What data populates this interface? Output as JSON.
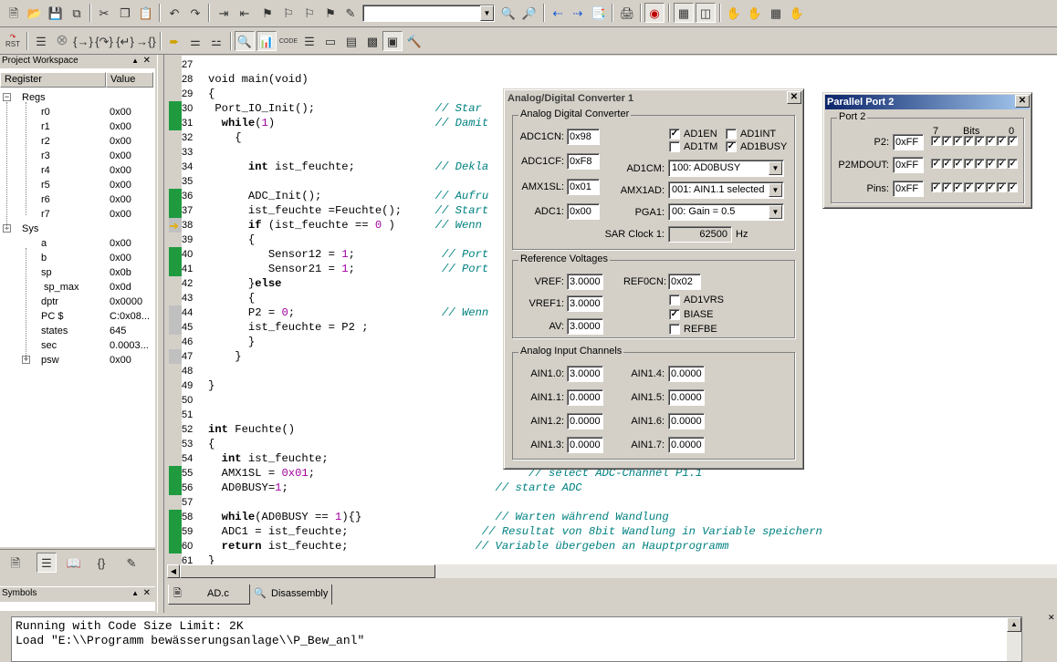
{
  "toolbar1": {
    "icons": [
      "new-file-icon",
      "open-folder-icon",
      "save-icon",
      "save-all-icon",
      "cut-icon",
      "copy-icon",
      "paste-icon",
      "undo-icon",
      "redo-icon",
      "indent-icon",
      "unindent-icon",
      "bookmark-icon",
      "bookmark-next-icon",
      "bookmark-prev-icon",
      "bookmark-clear-icon",
      "find-combo",
      "find-icon",
      "find-in-files-icon",
      "nav-back-icon",
      "nav-forward-icon",
      "source-browser-icon",
      "print-icon",
      "debug-session-icon",
      "window-icon",
      "window-tile-icon",
      "hand-icon",
      "hand2-icon",
      "grid-icon",
      "hand3-icon"
    ],
    "find_value": ""
  },
  "toolbar2": {
    "rst": "RST"
  },
  "workspace": {
    "title": "Project Workspace",
    "col_register": "Register",
    "col_value": "Value",
    "regs_label": "Regs",
    "sys_label": "Sys",
    "regs": [
      {
        "name": "r0",
        "value": "0x00"
      },
      {
        "name": "r1",
        "value": "0x00"
      },
      {
        "name": "r2",
        "value": "0x00"
      },
      {
        "name": "r3",
        "value": "0x00"
      },
      {
        "name": "r4",
        "value": "0x00"
      },
      {
        "name": "r5",
        "value": "0x00"
      },
      {
        "name": "r6",
        "value": "0x00"
      },
      {
        "name": "r7",
        "value": "0x00"
      }
    ],
    "sys": [
      {
        "name": "a",
        "value": "0x00"
      },
      {
        "name": "b",
        "value": "0x00"
      },
      {
        "name": "sp",
        "value": "0x0b"
      },
      {
        "name": "sp_max",
        "value": "0x0d"
      },
      {
        "name": "dptr",
        "value": "0x0000"
      },
      {
        "name": "PC  $",
        "value": "C:0x08..."
      },
      {
        "name": "states",
        "value": "645"
      },
      {
        "name": "sec",
        "value": "0.0003..."
      },
      {
        "name": "psw",
        "value": "0x00"
      }
    ]
  },
  "symbols": {
    "title": "Symbols"
  },
  "editor": {
    "lines": [
      {
        "n": "27",
        "m": "",
        "t": ""
      },
      {
        "n": "28",
        "m": "",
        "t": "void main(void)"
      },
      {
        "n": "29",
        "m": "",
        "t": "{"
      },
      {
        "n": "30",
        "m": "g",
        "t": " Port_IO_Init();                  // Star"
      },
      {
        "n": "31",
        "m": "g",
        "t": "  while(1)                        // Damit"
      },
      {
        "n": "32",
        "m": "",
        "t": "    {"
      },
      {
        "n": "33",
        "m": "",
        "t": ""
      },
      {
        "n": "34",
        "m": "",
        "t": "      int ist_feuchte;            // Dekla"
      },
      {
        "n": "35",
        "m": "",
        "t": ""
      },
      {
        "n": "36",
        "m": "g",
        "t": "      ADC_Init();                 // Aufru"
      },
      {
        "n": "37",
        "m": "g",
        "t": "      ist_feuchte =Feuchte();     // Start"
      },
      {
        "n": "38",
        "m": "y",
        "t": "      if (ist_feuchte == 0 )      // Wenn"
      },
      {
        "n": "39",
        "m": "",
        "t": "      {"
      },
      {
        "n": "40",
        "m": "g",
        "t": "         Sensor12 = 1;             // Port"
      },
      {
        "n": "41",
        "m": "g",
        "t": "         Sensor21 = 1;             // Port"
      },
      {
        "n": "42",
        "m": "",
        "t": "      }else"
      },
      {
        "n": "43",
        "m": "",
        "t": "      {"
      },
      {
        "n": "44",
        "m": "y",
        "t": "      P2 = 0;                      // Wenn"
      },
      {
        "n": "45",
        "m": "y",
        "t": "      ist_feuchte = P2 ;"
      },
      {
        "n": "46",
        "m": "",
        "t": "      }"
      },
      {
        "n": "47",
        "m": "y",
        "t": "    }"
      },
      {
        "n": "48",
        "m": "",
        "t": ""
      },
      {
        "n": "49",
        "m": "",
        "t": "}"
      },
      {
        "n": "50",
        "m": "",
        "t": ""
      },
      {
        "n": "51",
        "m": "",
        "t": ""
      },
      {
        "n": "52",
        "m": "",
        "t": "int Feuchte()"
      },
      {
        "n": "53",
        "m": "",
        "t": "{"
      },
      {
        "n": "54",
        "m": "",
        "t": "  int ist_feuchte;"
      },
      {
        "n": "55",
        "m": "g",
        "t": "  AMX1SL = 0x01;                                // select ADC-Channel P1.1"
      },
      {
        "n": "56",
        "m": "g",
        "t": "  AD0BUSY=1;                               // starte ADC"
      },
      {
        "n": "57",
        "m": "",
        "t": ""
      },
      {
        "n": "58",
        "m": "g",
        "t": "  while(AD0BUSY == 1){}                    // Warten während Wandlung"
      },
      {
        "n": "59",
        "m": "g",
        "t": "  ADC1 = ist_feuchte;                    // Resultat von 8bit Wandlung in Variable speichern"
      },
      {
        "n": "60",
        "m": "g",
        "t": "  return ist_feuchte;                   // Variable übergeben an Hauptprogramm"
      },
      {
        "n": "61",
        "m": "",
        "t": "}"
      }
    ],
    "tabs": [
      {
        "label": "AD.c"
      },
      {
        "label": "Disassembly"
      }
    ]
  },
  "adc_dialog": {
    "title": "Analog/Digital Converter 1",
    "grp_adc": "Analog Digital Converter",
    "adc1cn_label": "ADC1CN:",
    "adc1cn": "0x98",
    "adc1cf_label": "ADC1CF:",
    "adc1cf": "0xF8",
    "amx1sl_label": "AMX1SL:",
    "amx1sl": "0x01",
    "adc1_label": "ADC1:",
    "adc1": "0x00",
    "ad1en": "AD1EN",
    "ad1int": "AD1INT",
    "ad1tm": "AD1TM",
    "ad1busy": "AD1BUSY",
    "ad1cm_label": "AD1CM:",
    "ad1cm": "100: AD0BUSY",
    "amx1ad_label": "AMX1AD:",
    "amx1ad": "001: AIN1.1 selected",
    "pga1_label": "PGA1:",
    "pga1": "00: Gain = 0.5",
    "sar_label": "SAR Clock 1:",
    "sar": "62500",
    "sar_unit": "Hz",
    "grp_ref": "Reference Voltages",
    "vref_label": "VREF:",
    "vref": "3.0000",
    "vref1_label": "VREF1:",
    "vref1": "3.0000",
    "av_label": "AV:",
    "av": "3.0000",
    "ref0cn_label": "REF0CN:",
    "ref0cn": "0x02",
    "ad1vrs": "AD1VRS",
    "biase": "BIASE",
    "refbe": "REFBE",
    "grp_ain": "Analog Input Channels",
    "ain": [
      {
        "label": "AIN1.0:",
        "value": "3.0000"
      },
      {
        "label": "AIN1.1:",
        "value": "0.0000"
      },
      {
        "label": "AIN1.2:",
        "value": "0.0000"
      },
      {
        "label": "AIN1.3:",
        "value": "0.0000"
      },
      {
        "label": "AIN1.4:",
        "value": "0.0000"
      },
      {
        "label": "AIN1.5:",
        "value": "0.0000"
      },
      {
        "label": "AIN1.6:",
        "value": "0.0000"
      },
      {
        "label": "AIN1.7:",
        "value": "0.0000"
      }
    ]
  },
  "pp_dialog": {
    "title": "Parallel Port 2",
    "grp": "Port 2",
    "bits_hi": "7",
    "bits_label": "Bits",
    "bits_lo": "0",
    "p2_label": "P2:",
    "p2": "0xFF",
    "p2mdout_label": "P2MDOUT:",
    "p2mdout": "0xFF",
    "pins_label": "Pins:",
    "pins": "0xFF"
  },
  "output": {
    "lines": [
      "Running with Code Size Limit: 2K",
      "Load \"E:\\\\Programm bewässerungsanlage\\\\P_Bew_anl\""
    ]
  }
}
